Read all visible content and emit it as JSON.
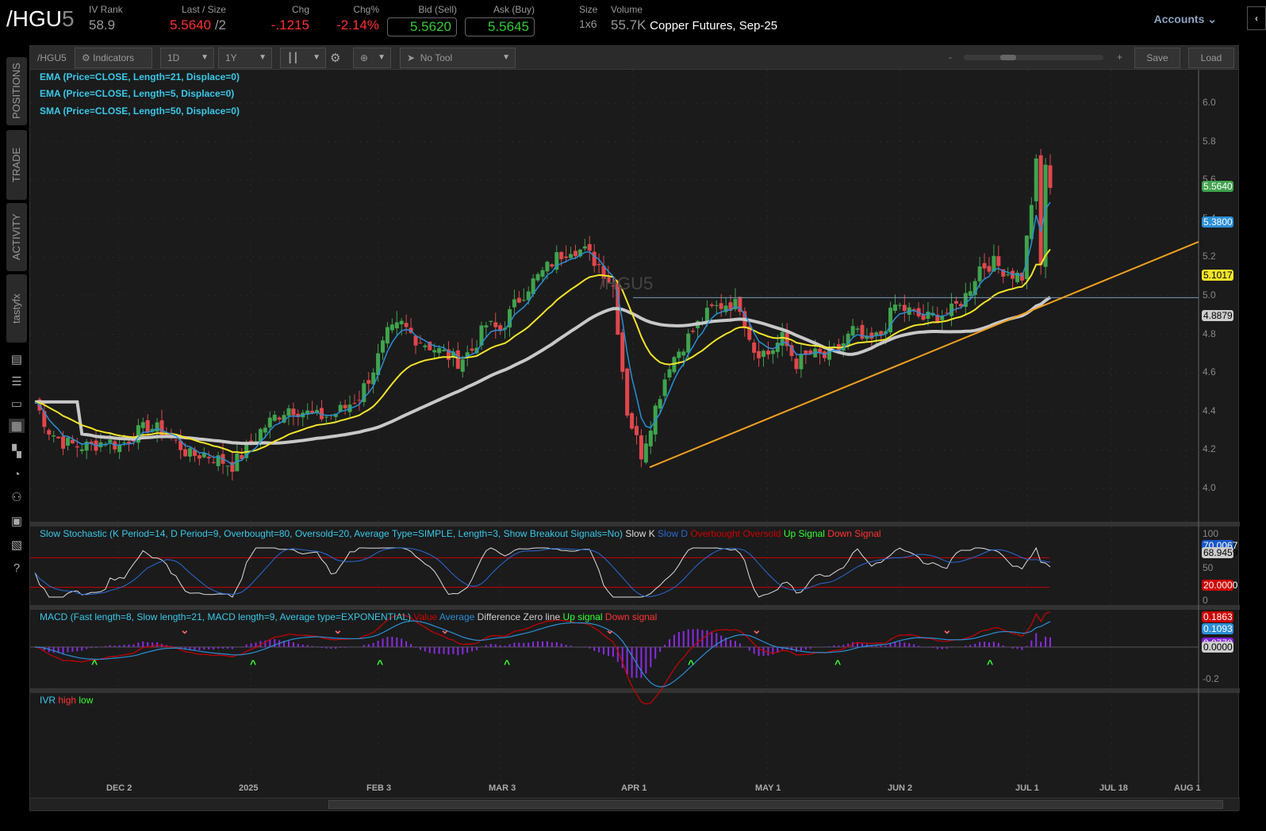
{
  "header": {
    "symbol_main": "/HGU",
    "symbol_suffix": "5",
    "iv_rank_label": "IV Rank",
    "iv_rank": "58.9",
    "last_label": "Last / Size",
    "last": "5.5640",
    "size": " /2",
    "chg_label": "Chg",
    "chg": "-.1215",
    "chgpct_label": "Chg%",
    "chgpct": "-2.14%",
    "bid_label": "Bid (Sell)",
    "bid": "5.5620",
    "ask_label": "Ask (Buy)",
    "ask": "5.5645",
    "sz_label": "Size",
    "sz": "1x6",
    "vol_label": "Volume",
    "vol": "55.7K",
    "desc": "Copper Futures, Sep-25",
    "accounts": "Accounts"
  },
  "sidebar": {
    "tabs": [
      "POSITIONS",
      "TRADE",
      "ACTIVITY",
      "tastyfx"
    ]
  },
  "toolbar": {
    "symbol": "/HGU5",
    "indicators": "Indicators",
    "interval": "1D",
    "range": "1Y",
    "tool": "No Tool",
    "zoom_minus": "-",
    "zoom_plus": "+",
    "save": "Save",
    "load": "Load"
  },
  "studies": {
    "ema21": "EMA (Price=CLOSE, Length=21, Displace=0)",
    "ema5": "EMA (Price=CLOSE, Length=5, Displace=0)",
    "sma50": "SMA (Price=CLOSE, Length=50, Displace=0)",
    "watermark": "/HGU5",
    "stoch": "Slow Stochastic (K Period=14, D Period=9, Overbought=80, Oversold=20, Average Type=SIMPLE, Length=3, Show Breakout Signals=No)",
    "stoch_legend": [
      "Slow K",
      "Slow D",
      "Overbought",
      "Oversold",
      "Up Signal",
      "Down Signal"
    ],
    "macd": "MACD (Fast length=8, Slow length=21, MACD length=9, Average type=EXPONENTIAL)",
    "macd_legend": [
      "Value",
      "Average",
      "Difference",
      "Zero line",
      "Up signal",
      "Down signal"
    ],
    "ivr": "IVR",
    "ivr_legend": [
      "high",
      "low"
    ]
  },
  "price_axis": {
    "ticks": [
      "6.0",
      "5.8",
      "5.6",
      "5.4",
      "5.2",
      "5.0",
      "4.8",
      "4.6",
      "4.4",
      "4.2",
      "4.0"
    ],
    "tags": {
      "last": "5.5640",
      "ema5": "5.3800",
      "ema21": "5.1017",
      "sma50": "4.8879"
    }
  },
  "stoch_axis": {
    "ticks": [
      "100",
      "50",
      "0"
    ],
    "tags": {
      "d": "70.0067",
      "k": "68.9459",
      "os": "20.0000"
    }
  },
  "macd_axis": {
    "ticks": [
      "-0.2"
    ],
    "tags": {
      "value": "0.1863",
      "avg": "0.1093",
      "diff": "0.0770",
      "zero": "0.0000"
    }
  },
  "dates": [
    "DEC 2",
    "2025",
    "FEB 3",
    "MAR 3",
    "APR 1",
    "MAY 1",
    "JUN 2",
    "JUL 1",
    "JUL 18",
    "AUG 1"
  ],
  "colors": {
    "up": "#3fa34d",
    "down": "#e0474c",
    "ema5": "#2a8fd6",
    "ema21": "#f2e42a",
    "sma50": "#c8c8c8",
    "trend": "#f0a020"
  },
  "chart_data": {
    "type": "candlestick",
    "ylim": [
      4.0,
      6.0
    ],
    "horizontal_line": 4.99,
    "closes": [
      4.45,
      4.3,
      4.24,
      4.22,
      4.22,
      4.25,
      4.22,
      4.28,
      4.32,
      4.3,
      4.24,
      4.17,
      4.18,
      4.15,
      4.12,
      4.2,
      4.3,
      4.37,
      4.42,
      4.4,
      4.37,
      4.38,
      4.42,
      4.48,
      4.62,
      4.8,
      4.85,
      4.78,
      4.74,
      4.7,
      4.66,
      4.72,
      4.85,
      4.82,
      4.95,
      5.05,
      5.12,
      5.2,
      5.25,
      5.23,
      5.16,
      5.05,
      4.4,
      4.18,
      4.42,
      4.65,
      4.75,
      4.85,
      4.93,
      4.96,
      4.95,
      4.72,
      4.7,
      4.78,
      4.65,
      4.7,
      4.68,
      4.72,
      4.82,
      4.75,
      4.8,
      4.95,
      4.92,
      4.88,
      4.9,
      4.92,
      5.0,
      5.15,
      5.17,
      5.12,
      5.1,
      5.68,
      5.56
    ]
  }
}
